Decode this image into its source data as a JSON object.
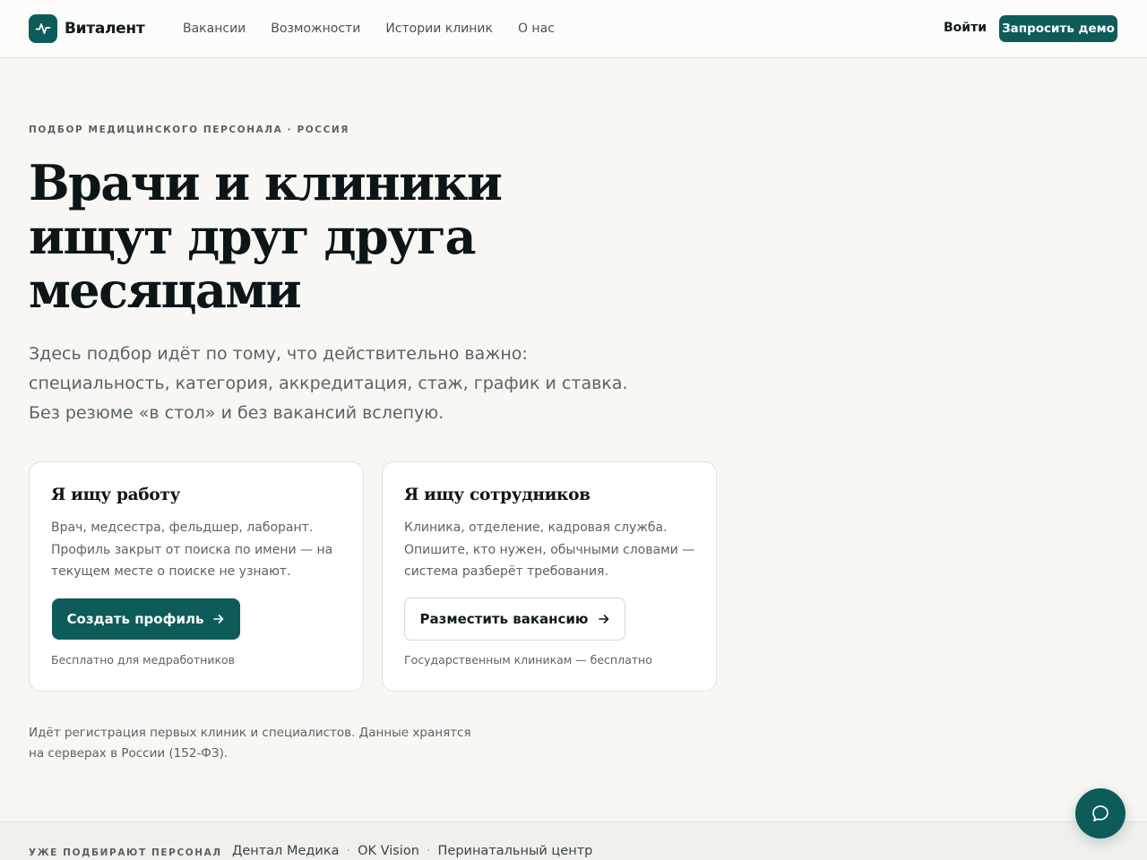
{
  "brand": {
    "name": "Виталент",
    "logo_icon": "pulse-icon",
    "accent_color": "#0d5c5a"
  },
  "nav": {
    "items": [
      "Вакансии",
      "Возможности",
      "Истории клиник",
      "О нас"
    ],
    "login_label": "Войти",
    "demo_label": "Запросить демо"
  },
  "hero": {
    "eyebrow": "ПОДБОР МЕДИЦИНСКОГО ПЕРСОНАЛА · РОССИЯ",
    "headline_lines": [
      "Врачи и клиники",
      "ищут друг друга",
      "месяцами"
    ],
    "lead_lines": [
      "Здесь подбор идёт по тому, что действительно важно:",
      "специальность, категория, аккредитация, стаж, график и ставка.",
      "Без резюме «в стол» и без вакансий вслепую."
    ]
  },
  "cards": {
    "job": {
      "title": "Я ищу работу",
      "desc_lines": [
        "Врач, медсестра, фельдшер, лаборант.",
        "Профиль закрыт от поиска по имени — на",
        "текущем месте о поиске не узнают."
      ],
      "button_label": "Создать профиль",
      "button_icon": "arrow-right-icon",
      "note": "Бесплатно для медработников"
    },
    "hire": {
      "title": "Я ищу сотрудников",
      "desc_lines": [
        "Клиника, отделение, кадровая служба.",
        "Опишите, кто нужен, обычными словами —",
        "система разберёт требования."
      ],
      "button_label": "Разместить вакансию",
      "button_icon": "arrow-right-icon",
      "note": "Государственным клиникам — бесплатно"
    }
  },
  "disclaimer_lines": [
    "Идёт регистрация первых клиник и специалистов. Данные хранятся",
    "на серверах в России (152-ФЗ)."
  ],
  "strip": {
    "label": "УЖЕ ПОДБИРАЮТ ПЕРСОНАЛ",
    "clients": [
      "Дентал Медика",
      "OK Vision",
      "Перинатальный центр"
    ],
    "separator": "·"
  },
  "chat": {
    "icon": "chat-bubble-icon"
  }
}
